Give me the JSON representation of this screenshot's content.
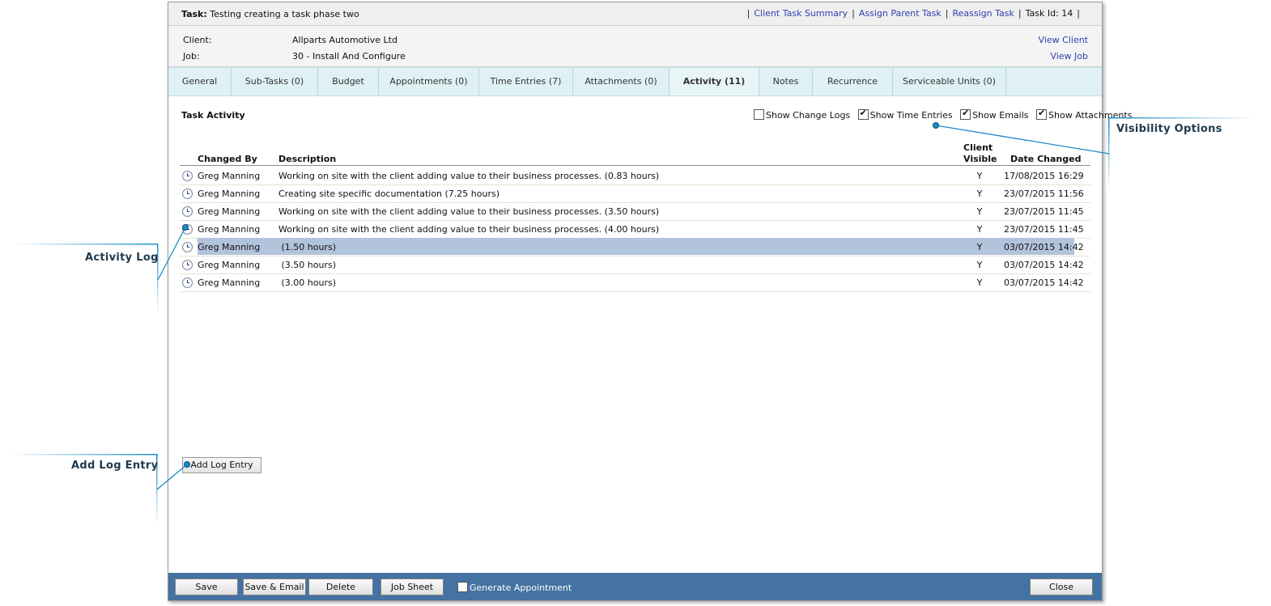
{
  "header": {
    "task_label": "Task:",
    "task_name": "Testing creating a task phase two",
    "links": {
      "client_task_summary": "Client Task Summary",
      "assign_parent_task": "Assign Parent Task",
      "reassign_task": "Reassign Task"
    },
    "task_id_label": "Task Id:",
    "task_id": "14"
  },
  "client_info": {
    "client_label": "Client:",
    "client_value": "Allparts Automotive Ltd",
    "job_label": "Job:",
    "job_value": "30 - Install And Configure",
    "view_client": "View Client",
    "view_job": "View Job"
  },
  "tabs": [
    {
      "label": "General"
    },
    {
      "label": "Sub-Tasks (0)"
    },
    {
      "label": "Budget"
    },
    {
      "label": "Appointments (0)"
    },
    {
      "label": "Time Entries (7)"
    },
    {
      "label": "Attachments (0)"
    },
    {
      "label": "Activity (11)"
    },
    {
      "label": "Notes"
    },
    {
      "label": "Recurrence"
    },
    {
      "label": "Serviceable Units (0)"
    }
  ],
  "activity": {
    "title": "Task Activity",
    "options": {
      "show_change_logs": "Show Change Logs",
      "show_time_entries": "Show Time Entries",
      "show_emails": "Show Emails",
      "show_attachments": "Show Attachments"
    },
    "options_checked": {
      "show_change_logs": false,
      "show_time_entries": true,
      "show_emails": true,
      "show_attachments": true
    },
    "columns": {
      "changed_by": "Changed By",
      "description": "Description",
      "client_visible_1": "Client",
      "client_visible_2": "Visible",
      "date_changed": "Date Changed"
    },
    "rows": [
      {
        "by": "Greg Manning",
        "desc": "Working on site with the client adding value to their business processes. (0.83 hours)",
        "visible": "Y",
        "date": "17/08/2015 16:29"
      },
      {
        "by": "Greg Manning",
        "desc": "Creating site specific documentation (7.25 hours)",
        "visible": "Y",
        "date": "23/07/2015 11:56"
      },
      {
        "by": "Greg Manning",
        "desc": "Working on site with the client adding value to their business processes. (3.50 hours)",
        "visible": "Y",
        "date": "23/07/2015 11:45"
      },
      {
        "by": "Greg Manning",
        "desc": "Working on site with the client adding value to their business processes. (4.00 hours)",
        "visible": "Y",
        "date": "23/07/2015 11:45"
      },
      {
        "by": "Greg Manning",
        "desc": " (1.50 hours)",
        "visible": "Y",
        "date": "03/07/2015 14:42"
      },
      {
        "by": "Greg Manning",
        "desc": " (3.50 hours)",
        "visible": "Y",
        "date": "03/07/2015 14:42"
      },
      {
        "by": "Greg Manning",
        "desc": " (3.00 hours)",
        "visible": "Y",
        "date": "03/07/2015 14:42"
      }
    ],
    "add_log_entry": "Add Log Entry"
  },
  "footer": {
    "save": "Save",
    "save_email": "Save & Email",
    "delete": "Delete",
    "job_sheet": "Job Sheet",
    "generate_appointment": "Generate Appointment",
    "close": "Close"
  },
  "callouts": {
    "visibility_options": "Visibility Options",
    "activity_log": "Activity Log",
    "add_log_entry": "Add Log Entry"
  },
  "colors": {
    "link": "#2e3fb0",
    "tab_bar": "#dff1f4",
    "selected_row": "#b2c3dc",
    "footer": "#4472a2",
    "callout_line": "#1a8bc6"
  }
}
